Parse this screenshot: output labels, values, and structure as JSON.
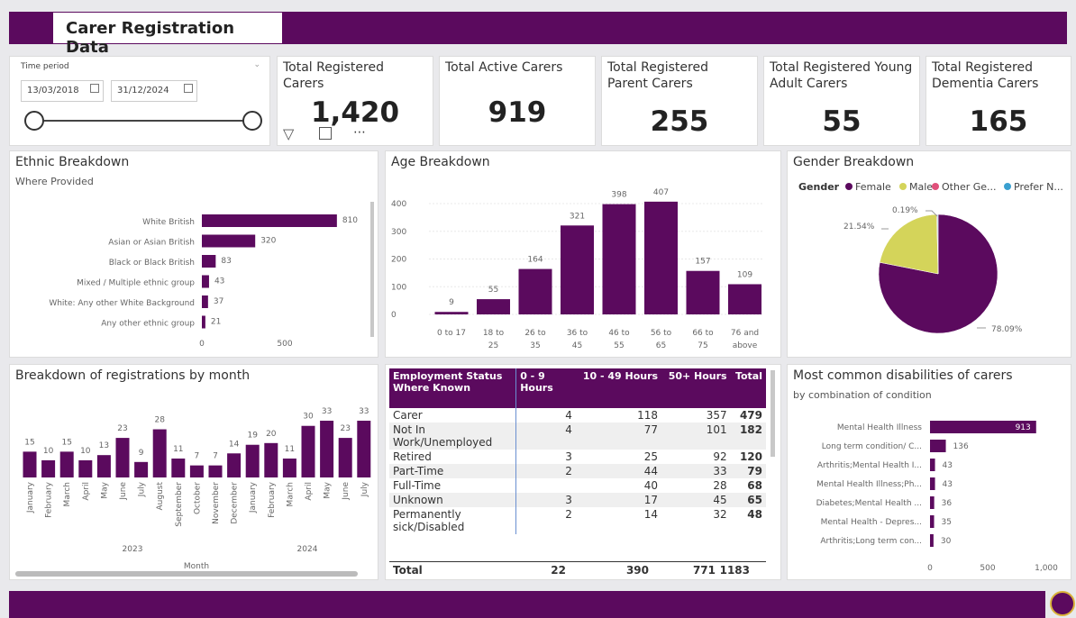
{
  "header": {
    "title": "Carer Registration Data"
  },
  "slicer": {
    "label": "Time period",
    "start_date": "13/03/2018",
    "end_date": "31/12/2024"
  },
  "kpis": [
    {
      "title": "Total Registered Carers",
      "value": "1,420"
    },
    {
      "title": "Total Active Carers",
      "value": "919"
    },
    {
      "title": "Total Registered Parent Carers",
      "value": "255"
    },
    {
      "title": "Total Registered Young Adult Carers",
      "value": "55"
    },
    {
      "title": "Total Registered Dementia Carers",
      "value": "165"
    }
  ],
  "ethnic": {
    "title": "Ethnic Breakdown",
    "subtitle": "Where Provided",
    "axis_ticks": [
      "0",
      "500"
    ]
  },
  "age": {
    "title": "Age Breakdown",
    "y_ticks": [
      "0",
      "100",
      "200",
      "300",
      "400"
    ]
  },
  "gender": {
    "title": "Gender Breakdown",
    "legend_label": "Gender",
    "legend": [
      {
        "name": "Female",
        "color": "#5b0a5e"
      },
      {
        "name": "Male",
        "color": "#d4d45a"
      },
      {
        "name": "Other Ge...",
        "color": "#e0507a"
      },
      {
        "name": "Prefer N...",
        "color": "#3aa0d0"
      }
    ],
    "labels": {
      "female": "78.09%",
      "male": "21.54%",
      "other": "0.19%"
    }
  },
  "monthly": {
    "title": "Breakdown of registrations by month",
    "years": [
      "2023",
      "2024"
    ],
    "axis_title": "Month"
  },
  "employment": {
    "headers": [
      "Employment Status Where Known",
      "0 - 9 Hours",
      "10 - 49 Hours",
      "50+ Hours",
      "Total"
    ],
    "rows": [
      [
        "Carer",
        "4",
        "118",
        "357",
        "479"
      ],
      [
        "Not In Work/Unemployed",
        "4",
        "77",
        "101",
        "182"
      ],
      [
        "Retired",
        "3",
        "25",
        "92",
        "120"
      ],
      [
        "Part-Time",
        "2",
        "44",
        "33",
        "79"
      ],
      [
        "Full-Time",
        "",
        "40",
        "28",
        "68"
      ],
      [
        "Unknown",
        "3",
        "17",
        "45",
        "65"
      ],
      [
        "Permanently sick/Disabled",
        "2",
        "14",
        "32",
        "48"
      ]
    ],
    "total": [
      "Total",
      "22",
      "390",
      "771",
      "1183"
    ]
  },
  "disabilities": {
    "title": "Most common disabilities of carers",
    "subtitle": "by combination of condition",
    "axis_ticks": [
      "0",
      "500",
      "1,000"
    ]
  },
  "colors": {
    "brand": "#5b0a5e",
    "male": "#d4d45a"
  },
  "chart_data": [
    {
      "type": "bar",
      "orientation": "horizontal",
      "title": "Ethnic Breakdown",
      "subtitle": "Where Provided",
      "categories": [
        "White British",
        "Asian or Asian British",
        "Black or Black British",
        "Mixed / Multiple ethnic group",
        "White: Any other White Background",
        "Any other ethnic group"
      ],
      "values": [
        810,
        320,
        83,
        43,
        37,
        21
      ],
      "xlim": [
        0,
        1000
      ]
    },
    {
      "type": "bar",
      "title": "Age Breakdown",
      "categories": [
        "0 to 17",
        "18 to 25",
        "26 to 35",
        "36 to 45",
        "46 to 55",
        "56 to 65",
        "66 to 75",
        "76 and above"
      ],
      "values": [
        9,
        55,
        164,
        321,
        398,
        407,
        157,
        109
      ],
      "ylim": [
        0,
        450
      ]
    },
    {
      "type": "pie",
      "title": "Gender Breakdown",
      "categories": [
        "Female",
        "Male",
        "Other Ge...",
        "Prefer N..."
      ],
      "values": [
        78.09,
        21.54,
        0.19,
        0.18
      ]
    },
    {
      "type": "bar",
      "title": "Breakdown of registrations by month",
      "categories": [
        "January",
        "February",
        "March",
        "April",
        "May",
        "June",
        "July",
        "August",
        "September",
        "October",
        "November",
        "December",
        "January",
        "February",
        "March",
        "April",
        "May",
        "June",
        "July"
      ],
      "values": [
        15,
        10,
        15,
        10,
        13,
        23,
        9,
        28,
        11,
        7,
        7,
        14,
        19,
        20,
        11,
        30,
        33,
        23,
        33
      ],
      "xlabel": "Month",
      "ylim": [
        0,
        36
      ]
    },
    {
      "type": "bar",
      "orientation": "horizontal",
      "title": "Most common disabilities of carers",
      "subtitle": "by combination of condition",
      "categories": [
        "Mental Health Illness",
        "Long term condition/ C...",
        "Arthritis;Mental Health I...",
        "Mental Health Illness;Ph...",
        "Diabetes;Mental Health ...",
        "Mental Health - Depres...",
        "Arthritis;Long term con..."
      ],
      "values": [
        913,
        136,
        43,
        43,
        36,
        35,
        30
      ],
      "xlim": [
        0,
        1000
      ]
    }
  ]
}
